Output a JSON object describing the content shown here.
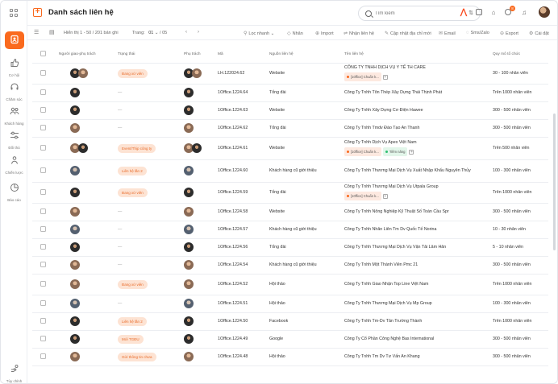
{
  "sidebar": {
    "items": [
      {
        "label": "Liên hệ",
        "icon": "contact-icon",
        "active": true
      },
      {
        "label": "Cơ hội",
        "icon": "thumb-up-icon"
      },
      {
        "label": "Chăm sóc",
        "icon": "headset-icon"
      },
      {
        "label": "Khách hàng",
        "icon": "customers-icon"
      },
      {
        "label": "Đối thủ",
        "icon": "sliders-icon"
      },
      {
        "label": "Chiến lược",
        "icon": "users-icon"
      },
      {
        "label": "Báo cáo",
        "icon": "pie-chart-icon"
      }
    ],
    "bottom": {
      "label": "Tùy chỉnh",
      "icon": "hand-settings-icon"
    }
  },
  "header": {
    "title": "Danh sách liên hệ",
    "search_placeholder": "Tìm kiếm",
    "notification_count": "8"
  },
  "toolbar": {
    "range_text": "Hiển thị 1 - 50 / 201 bản ghi",
    "page_label": "Trang:",
    "page_value": "01",
    "page_total": "/ 05",
    "actions": [
      "Lọc nhanh",
      "Nhãn",
      "Import",
      "Nhận liên hệ",
      "Cập nhật địa chỉ mới",
      "Email",
      "Sms/Zalo",
      "Export",
      "Cài đặt"
    ]
  },
  "table": {
    "columns": [
      "Người giao-phụ trách",
      "Trạng thái",
      "Phụ trách",
      "Mã",
      "Nguồn liên hệ",
      "Tên liên hệ",
      "Quy mô tổ chức"
    ],
    "rows": [
      {
        "status": "Đang xử viên",
        "code": "LH.122024.62",
        "source": "Website",
        "name": "CÔNG TY TNHH DỊCH VỤ Y TẾ TH CARE",
        "tags": [
          "[10ffice] Chuẩn k..."
        ],
        "size": "30 - 100 nhân viên",
        "av": "dark2"
      },
      {
        "status": "",
        "code": "1Office.1224.64",
        "source": "Tổng đài",
        "name": "Công Ty Tnhh Tôn Thép Xây Dựng Thái Thịnh Phát",
        "tags": [],
        "size": "Trên 1000 nhân viên",
        "av": "dark"
      },
      {
        "status": "",
        "code": "1Office.1224.63",
        "source": "Website",
        "name": "Công Ty Tnhh Xây Dựng Cơ Điện Hawee",
        "tags": [],
        "size": "300 - 500 nhân viên",
        "av": "dark"
      },
      {
        "status": "",
        "code": "1Office.1224.62",
        "source": "Tổng đài",
        "name": "Công Ty Tnhh Tmdv Đào Tạo An Thanh",
        "tags": [],
        "size": "300 - 500 nhân viên",
        "av": "light"
      },
      {
        "status": "Event/Thịp công ty",
        "code": "1Office.1224.61",
        "source": "Website",
        "name": "Công Ty Tnhh Dịch Vụ Apex Việt Nam",
        "tags": [
          "[10ffice] Chuẩn k...",
          "Tiềm năng"
        ],
        "size": "Trên 500 nhân viên",
        "av": "light2"
      },
      {
        "status": "Liên hệ lần 2",
        "code": "1Office.1224.60",
        "source": "Khách hàng cũ giới thiệu",
        "name": "Công Ty Tnhh Thương Mại Dịch Vụ Xuất Nhập Khẩu Nguyên Thủy",
        "tags": [],
        "size": "100 - 300 nhân viên",
        "av": "grey"
      },
      {
        "status": "Đang xử viên",
        "code": "1Office.1224.59",
        "source": "Tổng đài",
        "name": "Công Ty Tnhh Thương Mại Dịch Vụ Utpala Group",
        "tags": [
          "[10ffice] Chuẩn k..."
        ],
        "size": "Trên 1000 nhân viên",
        "av": "dark"
      },
      {
        "status": "",
        "code": "1Office.1224.58",
        "source": "Website",
        "name": "Công Ty Tnhh Nông Nghiệp Kỹ Thuật Số Toàn Cầu Spr",
        "tags": [],
        "size": "300 - 500 nhân viên",
        "av": "light"
      },
      {
        "status": "",
        "code": "1Office.1224.57",
        "source": "Khách hàng cũ giới thiệu",
        "name": "Công Ty Tnhh Nhân Liên Tm Dv Quốc Tế Norina",
        "tags": [],
        "size": "10 - 30 nhân viên",
        "av": "grey"
      },
      {
        "status": "",
        "code": "1Office.1224.56",
        "source": "Tổng đài",
        "name": "Công Ty Tnhh Thương Mại Dịch Vụ Vận Tải Lâm Hân",
        "tags": [],
        "size": "5 - 10 nhân viên",
        "av": "dark"
      },
      {
        "status": "",
        "code": "1Office.1224.54",
        "source": "Khách hàng cũ giới thiệu",
        "name": "Công Ty Tnhh Một Thành Viên Pmc 21",
        "tags": [],
        "size": "300 - 500 nhân viên",
        "av": "light"
      },
      {
        "status": "Đang xử viên",
        "code": "1Office.1224.52",
        "source": "Hội thảo",
        "name": "Công Ty Tnhh Giao Nhận Top Line Việt Nam",
        "tags": [],
        "size": "Trên 1000 nhân viên",
        "av": "light"
      },
      {
        "status": "",
        "code": "1Office.1224.51",
        "source": "Hội thảo",
        "name": "Công Ty Tnhh Thương Mại Dịch Vụ Mp Group",
        "tags": [],
        "size": "100 - 300 nhân viên",
        "av": "grey"
      },
      {
        "status": "Liên hệ lần 2",
        "code": "1Office.1224.50",
        "source": "Facebook",
        "name": "Công Ty Tnhh Tm-Dv Tân Trường Thành",
        "tags": [],
        "size": "Trên 1000 nhân viên",
        "av": "dark"
      },
      {
        "status": "Mới TGĐU",
        "code": "1Office.1224.49",
        "source": "Google",
        "name": "Công Ty Cổ Phần Công Nghệ Bas International",
        "tags": [],
        "size": "300 - 500 nhân viên",
        "av": "dark"
      },
      {
        "status": "Gửi thông tin chưa",
        "code": "1Office.1224.48",
        "source": "Hội thảo",
        "name": "Công Ty Tnhh Tm Dv Tư Vấn An Khang",
        "tags": [],
        "size": "300 - 500 nhân viên",
        "av": "light"
      }
    ]
  }
}
